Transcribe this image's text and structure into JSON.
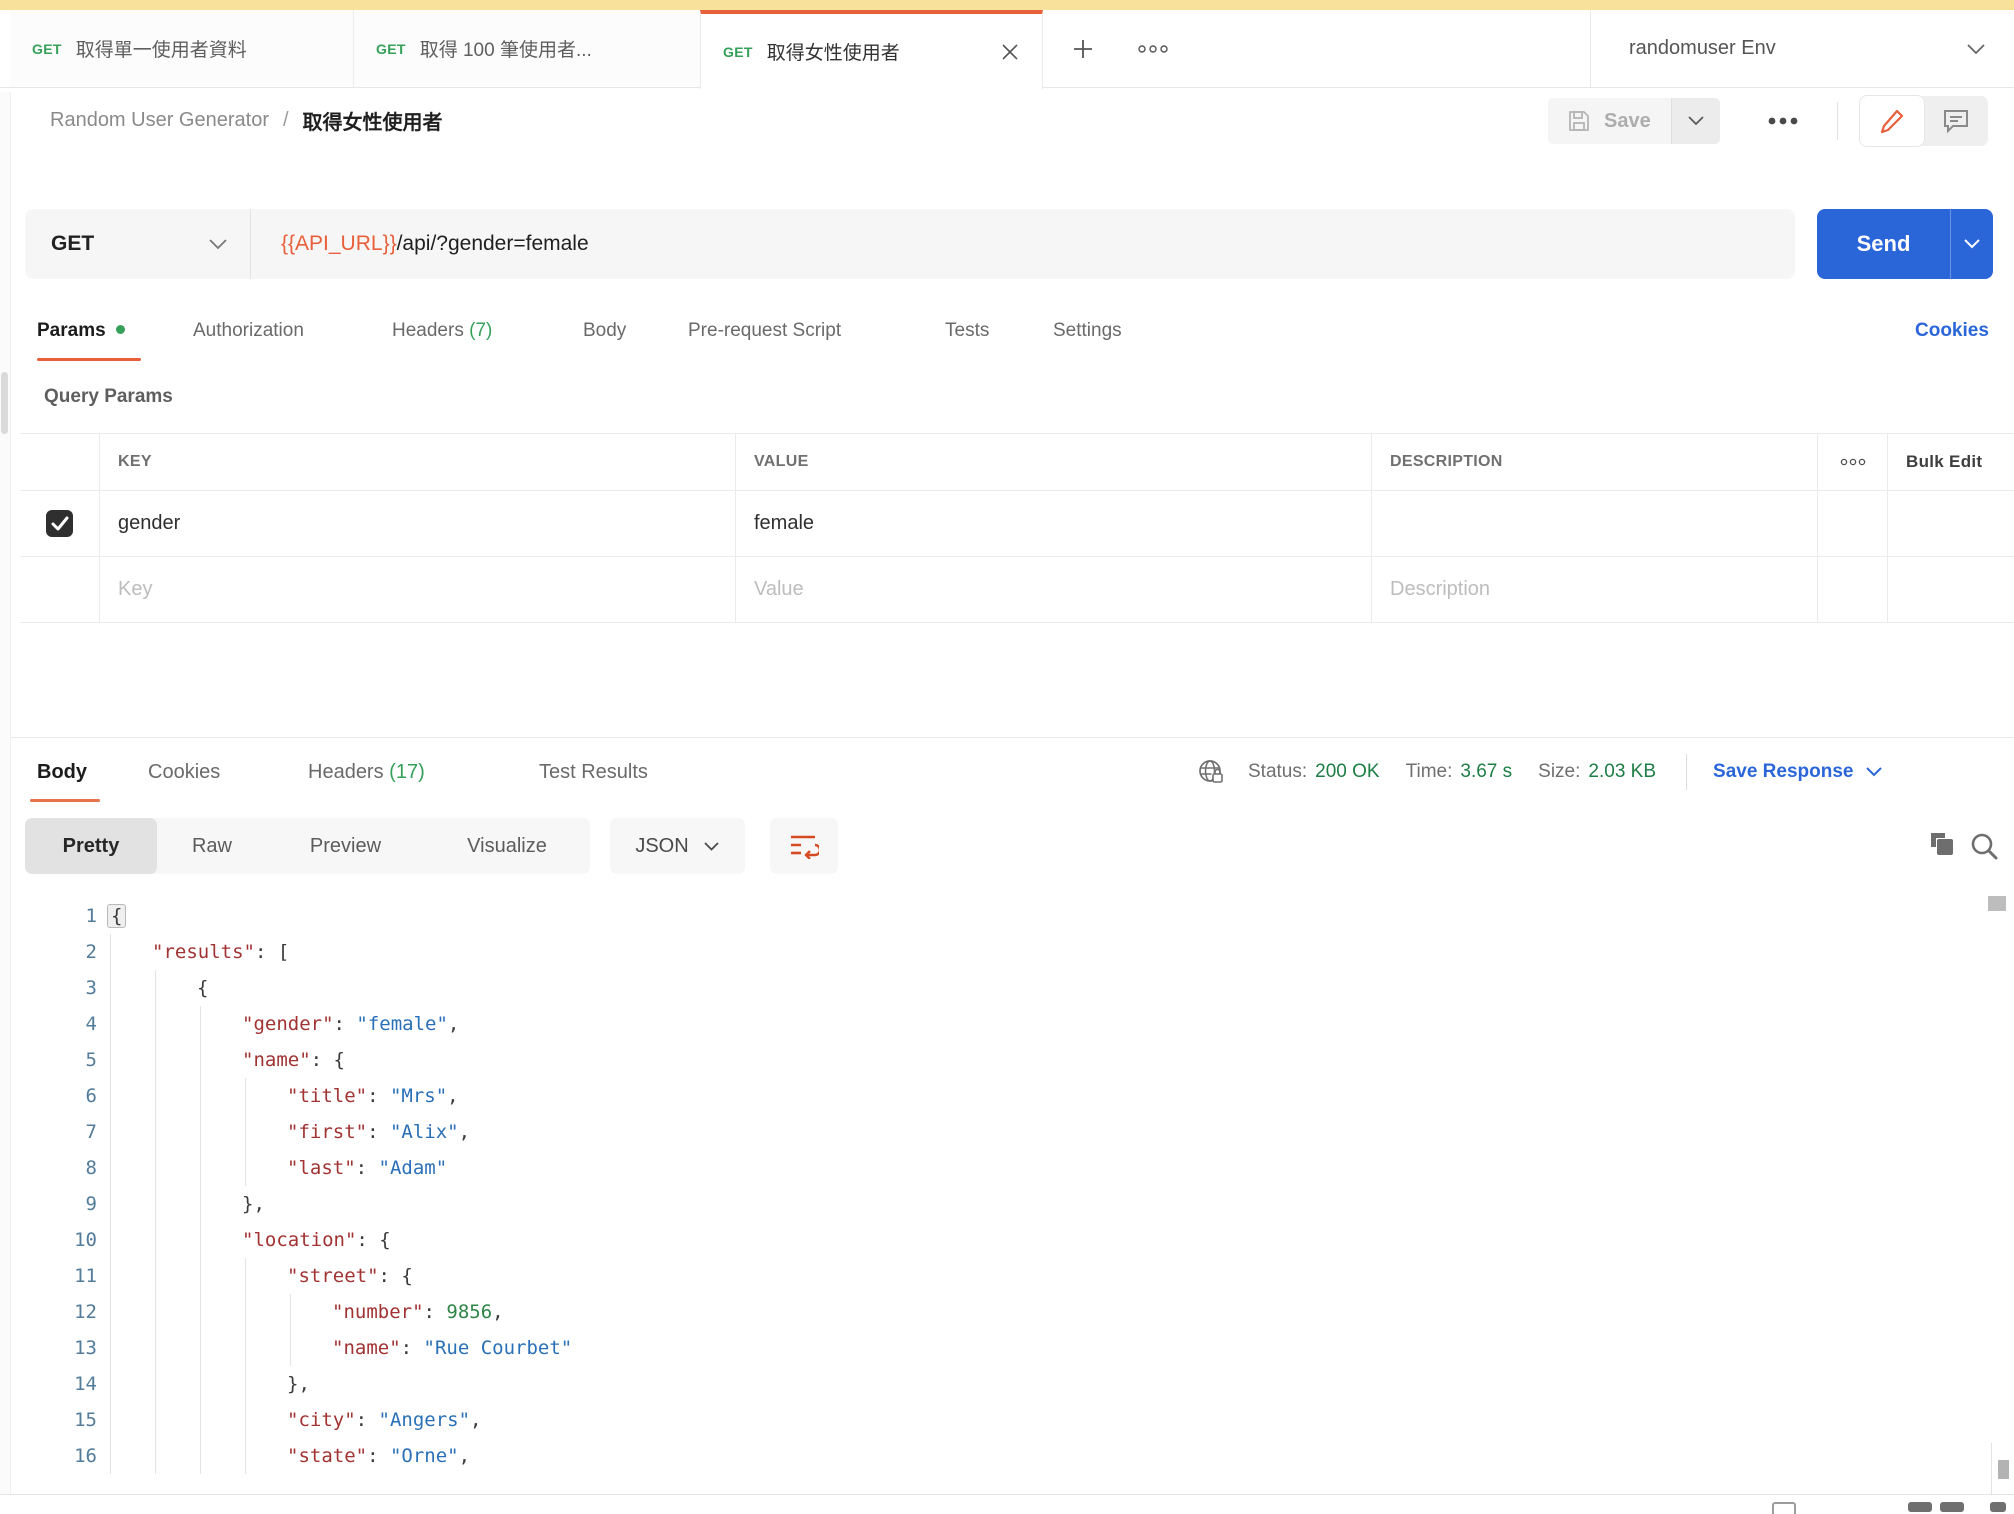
{
  "colors": {
    "banner_yellow": "#F8E29B",
    "brand_orange": "#E8603C",
    "send_blue": "#2B66D9",
    "link_blue": "#2B66D9",
    "get_green": "#35A05A",
    "ok_green": "#1E7E45",
    "key_red": "#A13332",
    "str_blue": "#2A70B8",
    "num_green": "#2E8547",
    "line_num": "#527C99"
  },
  "tabbar": {
    "tabs": [
      {
        "method": "GET",
        "title": "取得單一使用者資料"
      },
      {
        "method": "GET",
        "title": "取得 100 筆使用者..."
      },
      {
        "method": "GET",
        "title": "取得女性使用者"
      }
    ],
    "environment": {
      "name": "randomuser Env"
    }
  },
  "titlebar": {
    "breadcrumb": {
      "collection": "Random User Generator",
      "separator": "/",
      "request": "取得女性使用者"
    },
    "save_label": "Save"
  },
  "request": {
    "method": "GET",
    "url_variable": "{{API_URL}}",
    "url_path": "/api/?gender=female",
    "send_label": "Send"
  },
  "request_tabs": {
    "params": "Params",
    "authorization": "Authorization",
    "headers": "Headers",
    "headers_count": "(7)",
    "body": "Body",
    "prerequest": "Pre-request Script",
    "tests": "Tests",
    "settings": "Settings",
    "cookies_link": "Cookies"
  },
  "query_params": {
    "label": "Query Params",
    "columns": {
      "key": "KEY",
      "value": "VALUE",
      "description": "DESCRIPTION"
    },
    "bulk_edit": "Bulk Edit",
    "row": {
      "key": "gender",
      "value": "female",
      "description": ""
    },
    "placeholder_row": {
      "key": "Key",
      "value": "Value",
      "description": "Description"
    }
  },
  "response": {
    "tabs": {
      "body": "Body",
      "cookies": "Cookies",
      "headers": "Headers",
      "headers_count": "(17)",
      "test_results": "Test Results"
    },
    "meta": {
      "status_label": "Status:",
      "status_value": "200 OK",
      "time_label": "Time:",
      "time_value": "3.67 s",
      "size_label": "Size:",
      "size_value": "2.03 KB",
      "save_response": "Save Response"
    },
    "view": {
      "pretty": "Pretty",
      "raw": "Raw",
      "preview": "Preview",
      "visualize": "Visualize",
      "format": "JSON"
    }
  },
  "code": {
    "lines": [
      {
        "n": 1,
        "i": 0,
        "p": [
          {
            "t": "{",
            "c": "p",
            "h": true
          }
        ]
      },
      {
        "n": 2,
        "i": 1,
        "p": [
          {
            "t": "\"results\"",
            "c": "k"
          },
          {
            "t": ": [",
            "c": "p"
          }
        ]
      },
      {
        "n": 3,
        "i": 2,
        "p": [
          {
            "t": "{",
            "c": "p"
          }
        ]
      },
      {
        "n": 4,
        "i": 3,
        "p": [
          {
            "t": "\"gender\"",
            "c": "k"
          },
          {
            "t": ": ",
            "c": "p"
          },
          {
            "t": "\"female\"",
            "c": "s"
          },
          {
            "t": ",",
            "c": "p"
          }
        ]
      },
      {
        "n": 5,
        "i": 3,
        "p": [
          {
            "t": "\"name\"",
            "c": "k"
          },
          {
            "t": ": {",
            "c": "p"
          }
        ]
      },
      {
        "n": 6,
        "i": 4,
        "p": [
          {
            "t": "\"title\"",
            "c": "k"
          },
          {
            "t": ": ",
            "c": "p"
          },
          {
            "t": "\"Mrs\"",
            "c": "s"
          },
          {
            "t": ",",
            "c": "p"
          }
        ]
      },
      {
        "n": 7,
        "i": 4,
        "p": [
          {
            "t": "\"first\"",
            "c": "k"
          },
          {
            "t": ": ",
            "c": "p"
          },
          {
            "t": "\"Alix\"",
            "c": "s"
          },
          {
            "t": ",",
            "c": "p"
          }
        ]
      },
      {
        "n": 8,
        "i": 4,
        "p": [
          {
            "t": "\"last\"",
            "c": "k"
          },
          {
            "t": ": ",
            "c": "p"
          },
          {
            "t": "\"Adam\"",
            "c": "s"
          }
        ]
      },
      {
        "n": 9,
        "i": 3,
        "p": [
          {
            "t": "},",
            "c": "p"
          }
        ]
      },
      {
        "n": 10,
        "i": 3,
        "p": [
          {
            "t": "\"location\"",
            "c": "k"
          },
          {
            "t": ": {",
            "c": "p"
          }
        ]
      },
      {
        "n": 11,
        "i": 4,
        "p": [
          {
            "t": "\"street\"",
            "c": "k"
          },
          {
            "t": ": {",
            "c": "p"
          }
        ]
      },
      {
        "n": 12,
        "i": 5,
        "p": [
          {
            "t": "\"number\"",
            "c": "k"
          },
          {
            "t": ": ",
            "c": "p"
          },
          {
            "t": "9856",
            "c": "n"
          },
          {
            "t": ",",
            "c": "p"
          }
        ]
      },
      {
        "n": 13,
        "i": 5,
        "p": [
          {
            "t": "\"name\"",
            "c": "k"
          },
          {
            "t": ": ",
            "c": "p"
          },
          {
            "t": "\"Rue Courbet\"",
            "c": "s"
          }
        ]
      },
      {
        "n": 14,
        "i": 4,
        "p": [
          {
            "t": "},",
            "c": "p"
          }
        ]
      },
      {
        "n": 15,
        "i": 4,
        "p": [
          {
            "t": "\"city\"",
            "c": "k"
          },
          {
            "t": ": ",
            "c": "p"
          },
          {
            "t": "\"Angers\"",
            "c": "s"
          },
          {
            "t": ",",
            "c": "p"
          }
        ]
      },
      {
        "n": 16,
        "i": 4,
        "p": [
          {
            "t": "\"state\"",
            "c": "k"
          },
          {
            "t": ": ",
            "c": "p"
          },
          {
            "t": "\"Orne\"",
            "c": "s"
          },
          {
            "t": ",",
            "c": "p"
          }
        ]
      }
    ]
  }
}
